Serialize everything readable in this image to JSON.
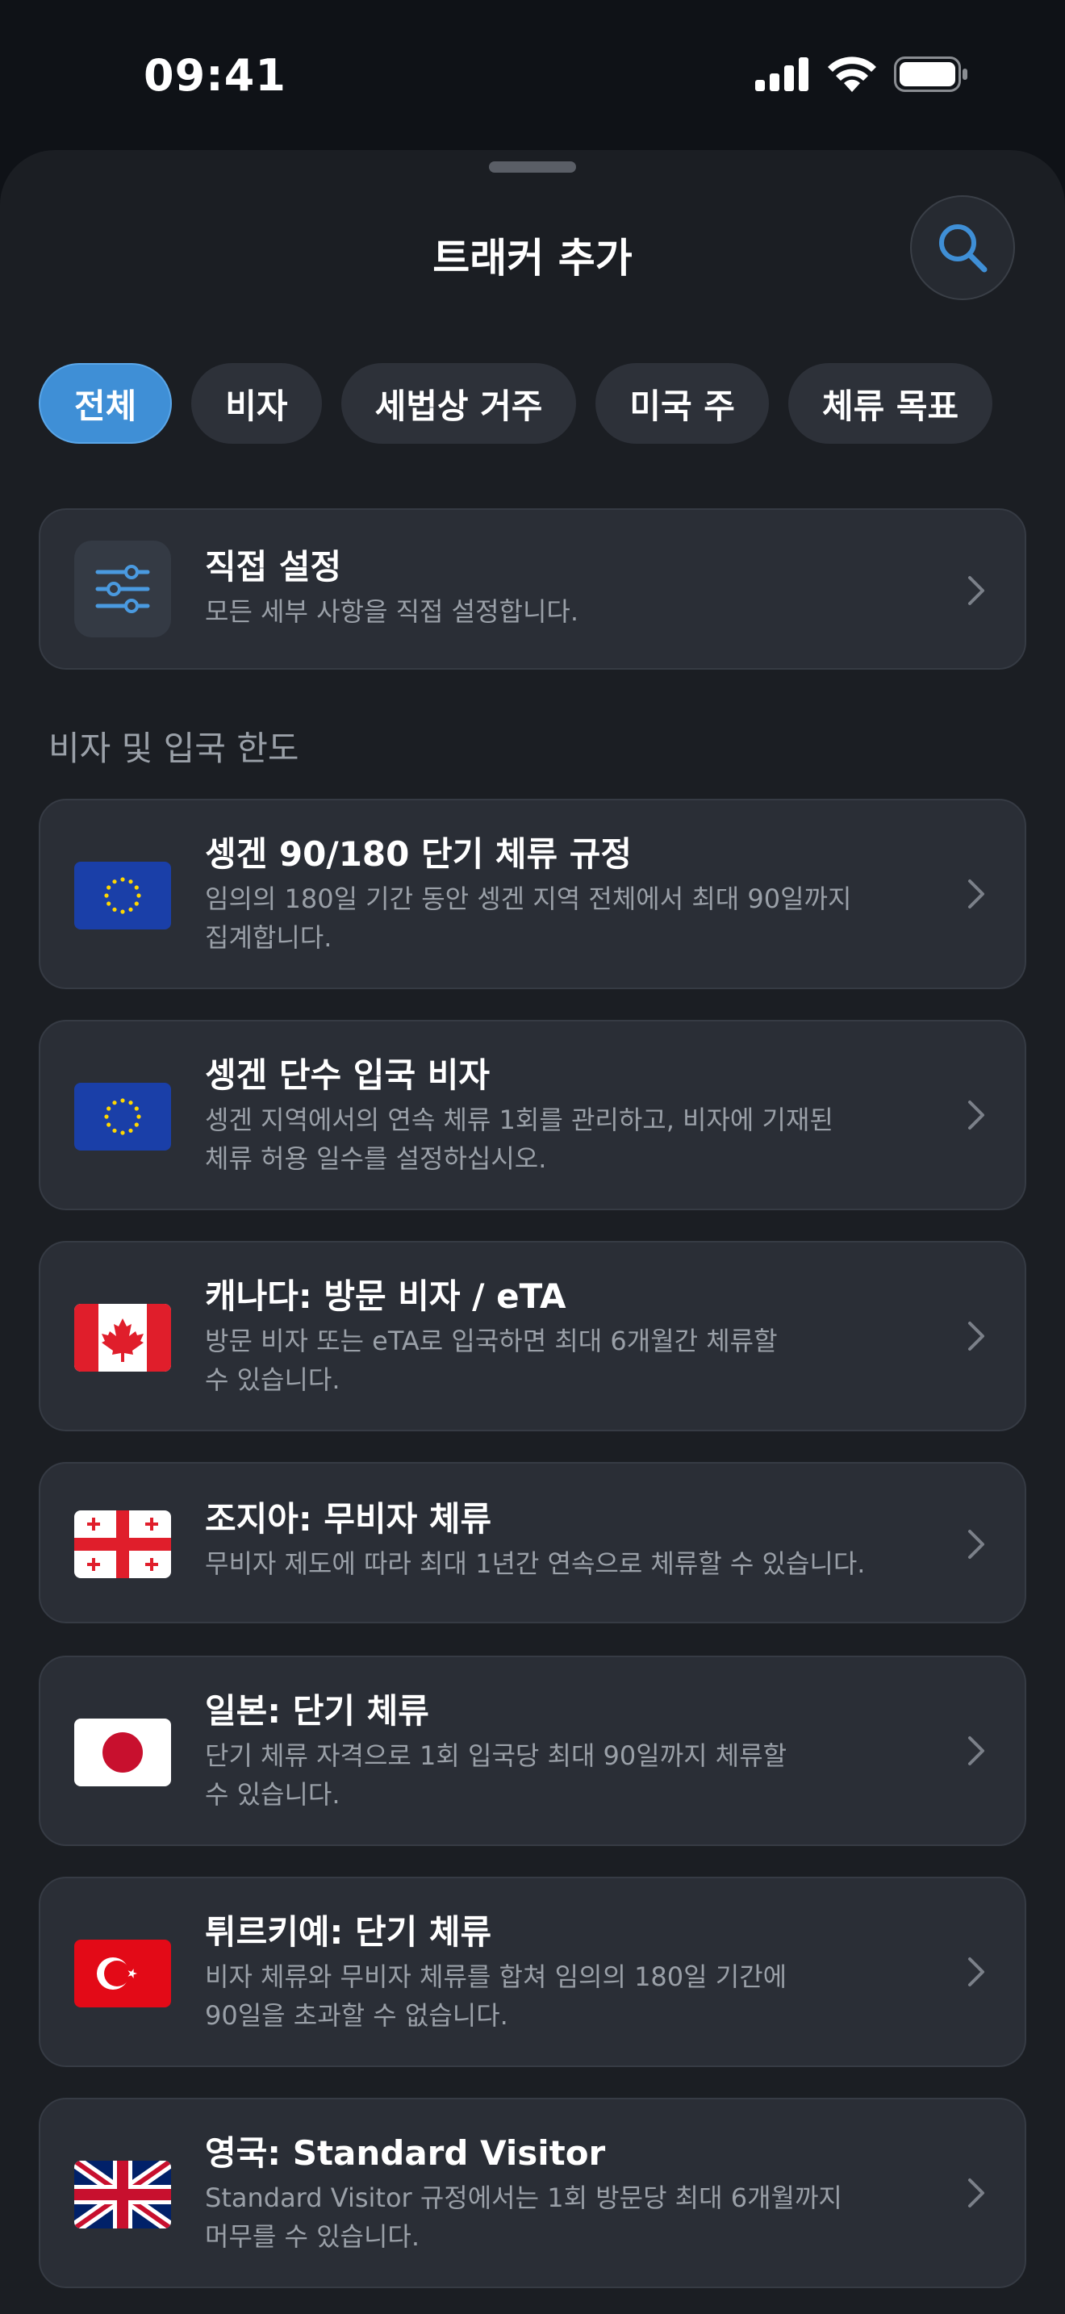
{
  "status": {
    "time": "09:41"
  },
  "header": {
    "title": "트래커 추가"
  },
  "chips": [
    "전체",
    "비자",
    "세법상 거주",
    "미국 주",
    "체류 목표"
  ],
  "custom": {
    "title": "직접 설정",
    "subtitle": "모든 세부 사항을 직접 설정합니다."
  },
  "section": {
    "label": "비자 및 입국 한도"
  },
  "items": [
    {
      "title": "셍겐 90/180 단기 체류 규정",
      "line1": "임의의 180일 기간 동안 셍겐 지역 전체에서 최대 90일까지",
      "line2": "집계합니다.",
      "flag": "eu"
    },
    {
      "title": "셍겐 단수 입국 비자",
      "line1": "셍겐 지역에서의 연속 체류 1회를 관리하고, 비자에 기재된",
      "line2": "체류 허용 일수를 설정하십시오.",
      "flag": "eu"
    },
    {
      "title": "캐나다: 방문 비자 / eTA",
      "line1": "방문 비자 또는 eTA로 입국하면 최대 6개월간 체류할",
      "line2": "수 있습니다.",
      "flag": "canada"
    },
    {
      "title": "조지아: 무비자 체류",
      "line1": "무비자 제도에 따라 최대 1년간 연속으로 체류할 수 있습니다.",
      "line2": "",
      "flag": "georgia"
    },
    {
      "title": "일본: 단기 체류",
      "line1": "단기 체류 자격으로 1회 입국당 최대 90일까지 체류할",
      "line2": "수 있습니다.",
      "flag": "japan"
    },
    {
      "title": "튀르키예: 단기 체류",
      "line1": "비자 체류와 무비자 체류를 합쳐 임의의 180일 기간에",
      "line2": "90일을 초과할 수 없습니다.",
      "flag": "turkey"
    },
    {
      "title": "영국: Standard Visitor",
      "line1": "Standard Visitor 규정에서는 1회 방문당 최대 6개월까지",
      "line2": "머무를 수 있습니다.",
      "flag": "uk"
    }
  ]
}
